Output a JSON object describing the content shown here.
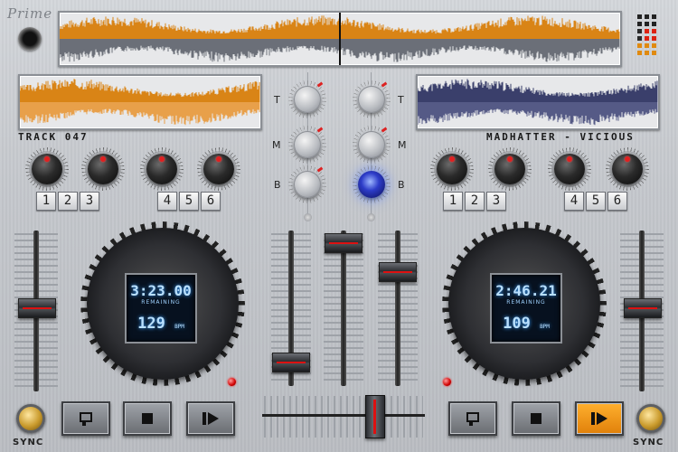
{
  "app": {
    "logo": "Prime"
  },
  "deck_a": {
    "track_name": "TRACK 047",
    "time": "3:23.00",
    "remaining_label": "REMAINING",
    "bpm": "129",
    "bpm_unit": "BPM",
    "cue_buttons": [
      "1",
      "2",
      "3"
    ],
    "cue_buttons_b": [
      "4",
      "5",
      "6"
    ],
    "pitch_fader_value": 0.5
  },
  "deck_b": {
    "track_name": "MADHATTER - VICIOUS",
    "time": "2:46.21",
    "remaining_label": "REMAINING",
    "bpm": "109",
    "bpm_unit": "BPM",
    "cue_buttons": [
      "1",
      "2",
      "3"
    ],
    "cue_buttons_b": [
      "4",
      "5",
      "6"
    ],
    "pitch_fader_value": 0.5
  },
  "mixer": {
    "eq_labels_left": [
      "T",
      "M",
      "B"
    ],
    "eq_labels_right": [
      "T",
      "M",
      "B"
    ],
    "channel_a_level": 0.2,
    "channel_b_level": 0.95,
    "master_level": 0.75,
    "crossfader": 0.6
  },
  "sync": {
    "left_label": "SYNC",
    "right_label": "SYNC"
  },
  "transport_icons": [
    "cue-icon",
    "stop-icon",
    "play-pause-icon"
  ],
  "colors": {
    "deck_a_wave": "#d98416",
    "deck_b_wave": "#3a3f6b",
    "overview_bottom": "#6b6f78",
    "jog_a_ring": "#e0b020",
    "jog_b_ring": "#3f5fa8",
    "screen_text": "#9fd2ff",
    "play_active": "#ffa21a"
  }
}
